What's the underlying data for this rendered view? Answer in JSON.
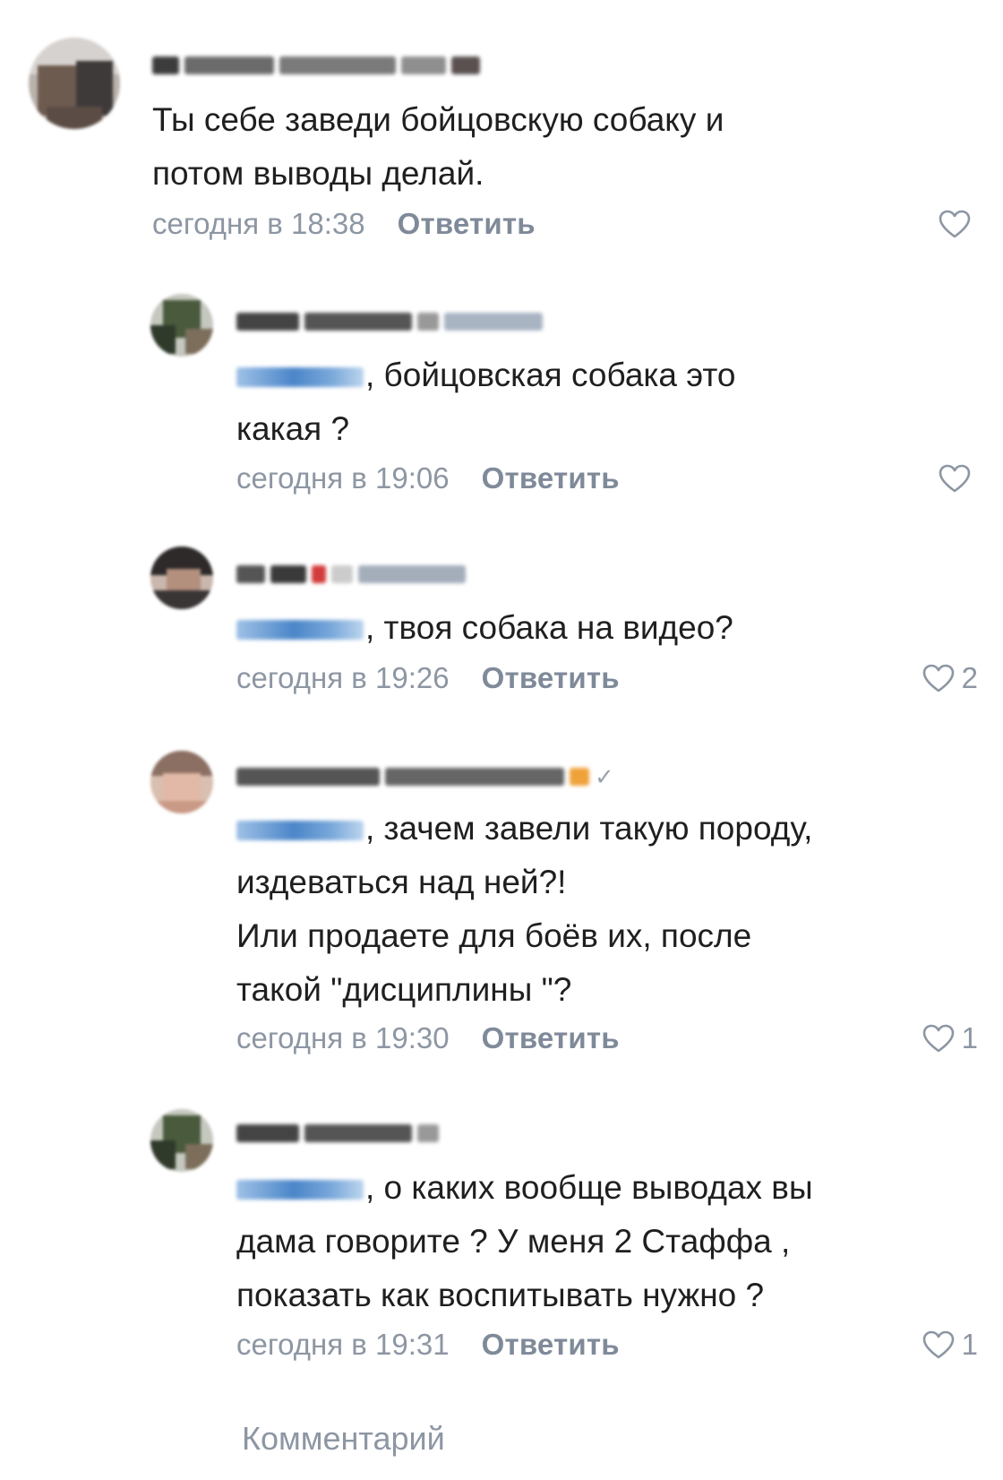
{
  "comments": [
    {
      "author": "",
      "text_lines": [
        "Ты себе заведи бойцовскую собаку и",
        "потом выводы делай."
      ],
      "mention": false,
      "time": "сегодня в 18:38",
      "reply_label": "Ответить",
      "likes": "",
      "icon": "heart-outline-icon"
    },
    {
      "author": "",
      "text_lines": [
        ", бойцовская собака это",
        "какая ?"
      ],
      "mention": true,
      "time": "сегодня в 19:06",
      "reply_label": "Ответить",
      "likes": "",
      "icon": "heart-outline-icon"
    },
    {
      "author": "",
      "text_lines": [
        ", твоя собака на видео?"
      ],
      "mention": true,
      "time": "сегодня в 19:26",
      "reply_label": "Ответить",
      "likes": "2",
      "icon": "heart-outline-icon"
    },
    {
      "author": "",
      "text_lines": [
        ", зачем завели такую породу,",
        "издеваться над ней?!",
        "Или продаете для боёв их, после",
        "такой \"дисциплины \"?"
      ],
      "mention": true,
      "time": "сегодня в 19:30",
      "reply_label": "Ответить",
      "likes": "1",
      "icon": "heart-outline-icon"
    },
    {
      "author": "",
      "text_lines": [
        ", о каких вообще выводах вы",
        "дама говорите ? У меня 2 Стаффа ,",
        "показать как воспитывать нужно ?"
      ],
      "mention": true,
      "time": "сегодня в 19:31",
      "reply_label": "Ответить",
      "likes": "1",
      "icon": "heart-outline-icon"
    }
  ],
  "composer": {
    "placeholder": "Комментарий"
  },
  "colors": {
    "meta_gray": "#8d96a3",
    "mention_blue": "#4b86c9",
    "text": "#1f1f1f"
  }
}
